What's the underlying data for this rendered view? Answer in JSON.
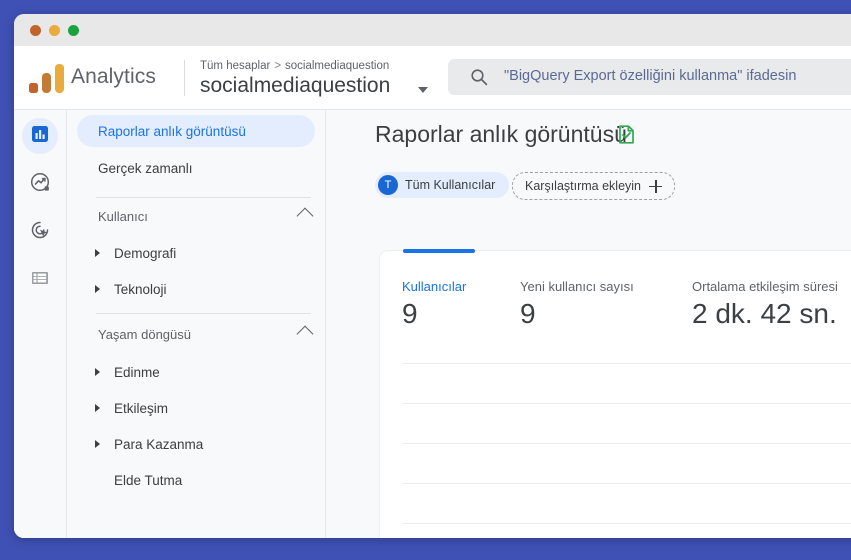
{
  "window": {
    "traffic_lights": [
      "close",
      "minimize",
      "maximize"
    ]
  },
  "header": {
    "brand": "Analytics",
    "logo_icon": "google-analytics-logo",
    "breadcrumb": {
      "root": "Tüm hesaplar",
      "separator": ">",
      "current": "socialmediaquestion"
    },
    "account_name": "socialmediaquestion",
    "account_caret_icon": "chevron-down-icon",
    "search": {
      "icon": "search-icon",
      "placeholder": "\"BigQuery Export özelliğini kullanma\" ifadesin"
    }
  },
  "rail": {
    "items": [
      {
        "icon": "reports-bar-chart-icon",
        "active": true
      },
      {
        "icon": "explore-trend-circle-icon",
        "active": false
      },
      {
        "icon": "advertising-target-cursor-icon",
        "active": false
      },
      {
        "icon": "configure-list-icon",
        "active": false
      }
    ]
  },
  "sidebar": {
    "items": [
      {
        "label": "Raporlar anlık görüntüsü",
        "selected": true
      },
      {
        "label": "Gerçek zamanlı",
        "selected": false
      }
    ],
    "sections": [
      {
        "title": "Kullanıcı",
        "collapse_icon": "chevron-up-icon",
        "items": [
          {
            "label": "Demografi",
            "expandable": true
          },
          {
            "label": "Teknoloji",
            "expandable": true
          }
        ]
      },
      {
        "title": "Yaşam döngüsü",
        "collapse_icon": "chevron-up-icon",
        "items": [
          {
            "label": "Edinme",
            "expandable": true
          },
          {
            "label": "Etkileşim",
            "expandable": true
          },
          {
            "label": "Para Kazanma",
            "expandable": true
          },
          {
            "label": "Elde Tutma",
            "expandable": false
          }
        ]
      }
    ]
  },
  "main": {
    "title": "Raporlar anlık görüntüsü",
    "title_icon": "document-check-green-icon",
    "chips": {
      "all_users": {
        "avatar_letter": "T",
        "label": "Tüm Kullanıcılar"
      },
      "add_comparison": {
        "label": "Karşılaştırma ekleyin",
        "icon": "plus-icon"
      }
    },
    "card": {
      "metrics": [
        {
          "label": "Kullanıcılar",
          "value": "9",
          "primary": true
        },
        {
          "label": "Yeni kullanıcı sayısı",
          "value": "9",
          "primary": false
        },
        {
          "label": "Ortalama etkileşim süresi",
          "value": "2 dk. 42 sn.",
          "primary": false
        }
      ]
    }
  },
  "colors": {
    "desktop": "#3f51b5",
    "accent_blue": "#1a73e8",
    "chip_blue_bg": "#e3edfd",
    "green_icon": "#34a853",
    "logo_orange_dark": "#c0642b",
    "logo_orange": "#e8ab3c"
  }
}
